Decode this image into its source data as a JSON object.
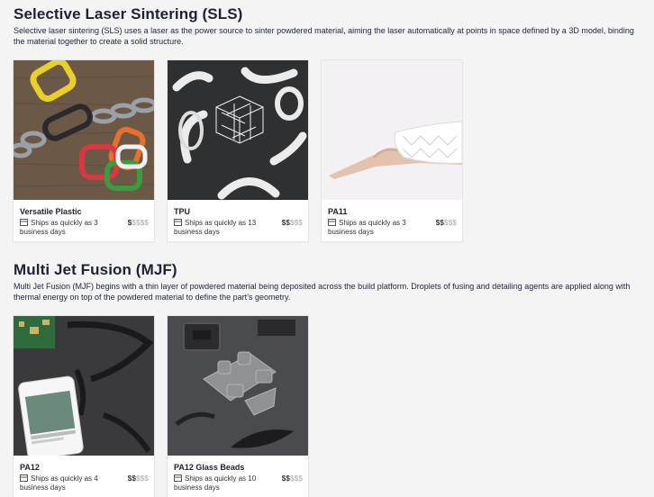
{
  "sls": {
    "title": "Selective Laser Sintering (SLS)",
    "description": "Selective laser sintering (SLS) uses a laser as the power source to sinter powdered material, aiming the laser automatically at points in space defined by a 3D model, binding the material together to create a solid structure.",
    "materials": [
      {
        "name": "Versatile Plastic",
        "ship": "Ships as quickly as 3 business days",
        "price_on": "$",
        "price_off": "$$$$",
        "image": "colored plastic chain links on wood"
      },
      {
        "name": "TPU",
        "ship": "Ships as quickly as 13 business days",
        "price_on": "$$",
        "price_off": "$$$",
        "image": "white flexible TPU parts"
      },
      {
        "name": "PA11",
        "ship": "Ships as quickly as 3 business days",
        "price_on": "$$",
        "price_off": "$$$",
        "image": "hand with white lattice wrist brace"
      }
    ]
  },
  "mjf": {
    "title": "Multi Jet Fusion (MJF)",
    "description": "Multi Jet Fusion (MJF) begins with a thin layer of powdered material being deposited across the build platform. Droplets of fusing and detailing agents are applied along with thermal energy on top of the powdered material to define the part’s geometry.",
    "materials": [
      {
        "name": "PA12",
        "ship": "Ships as quickly as 4 business days",
        "price_on": "$$",
        "price_off": "$$$",
        "image": "phone and black parts on dark wood"
      },
      {
        "name": "PA12 Glass Beads",
        "ship": "Ships as quickly as 10 business days",
        "price_on": "$$",
        "price_off": "$$$",
        "image": "grey glass-bead nylon parts"
      }
    ]
  },
  "icons": {
    "ship": "box-icon"
  }
}
